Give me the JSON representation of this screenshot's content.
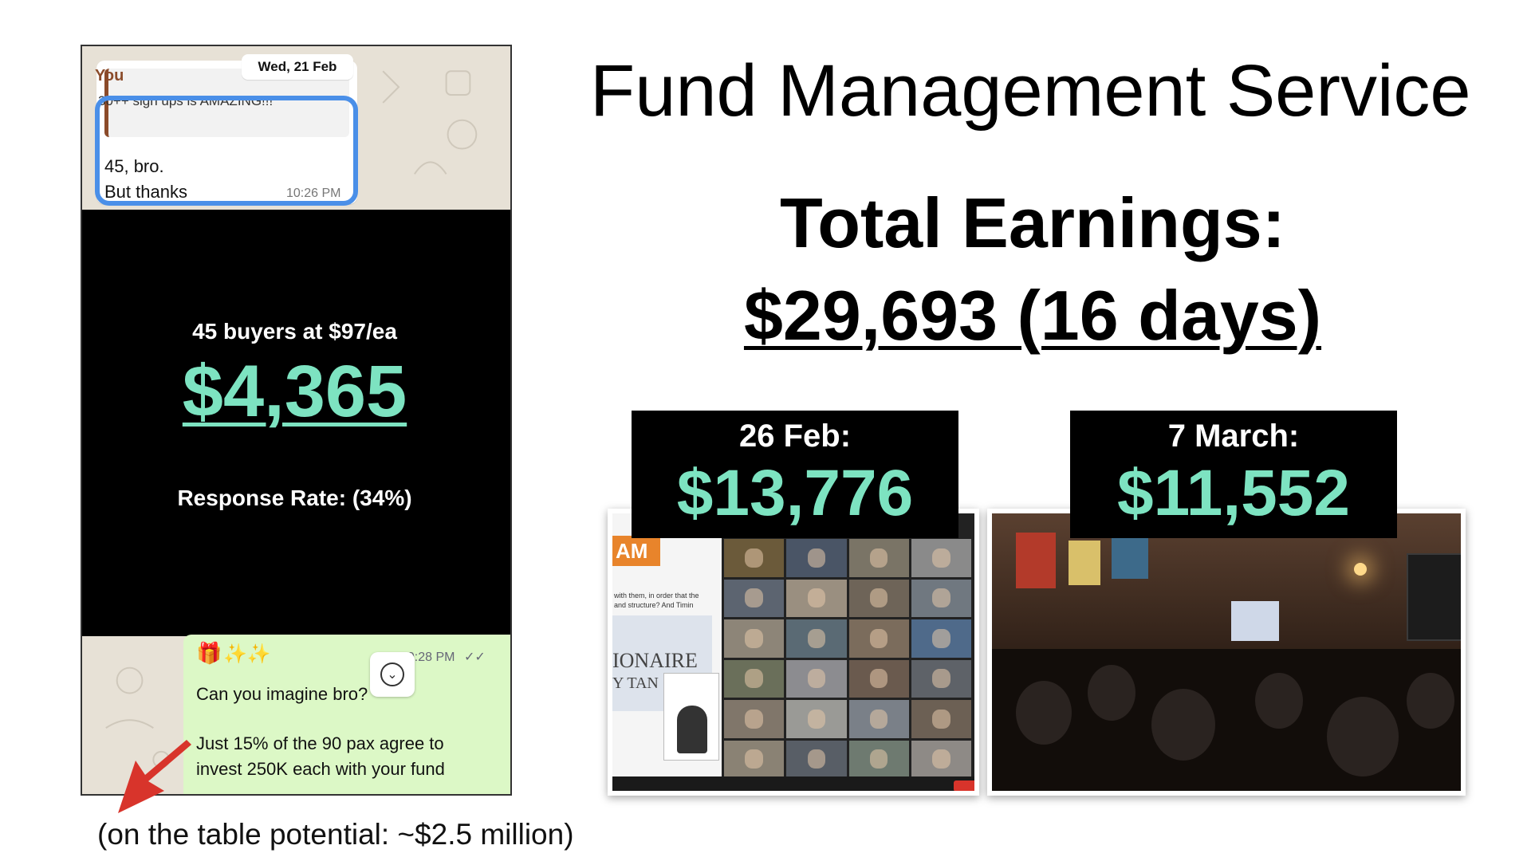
{
  "title": "Fund Management Service",
  "total_earnings": {
    "label": "Total Earnings:",
    "value": "$29,693 (16 days)"
  },
  "chat": {
    "date": "Wed, 21 Feb",
    "incoming": {
      "quote_author": "You",
      "quote_text": "30++ sign ups is AMAZING!!!",
      "line1": "45, bro.",
      "line2": "But thanks",
      "time": "10:26 PM"
    },
    "outgoing": {
      "time": "10:28 PM",
      "line1": "Can you imagine bro?",
      "line2": "Just 15% of the 90 pax agree to",
      "line3": "invest 250K each with your fund"
    }
  },
  "overlay": {
    "buyers": "45 buyers at $97/ea",
    "amount": "$4,365",
    "response_rate": "Response Rate: (34%)"
  },
  "potential_note": "(on the table potential: ~$2.5 million)",
  "events": [
    {
      "date": "26 Feb:",
      "amount": "$13,776"
    },
    {
      "date": "7 March:",
      "amount": "$11,552"
    }
  ],
  "zoom_slide": {
    "tag": "AM",
    "text1": "with them, in order that the",
    "text2": "and structure? And Timin",
    "slide_line1": "IONAIRE",
    "slide_line2": "Y TAN"
  },
  "colors": {
    "accent_teal": "#7de3c1",
    "highlight_blue": "#4a8fe8",
    "arrow_red": "#d8342b",
    "chat_green": "#dcf8c6"
  },
  "icons": {
    "gift": "🎁",
    "sparkles": "✨✨",
    "read_check": "✓✓",
    "scroll_down": "⌄"
  }
}
